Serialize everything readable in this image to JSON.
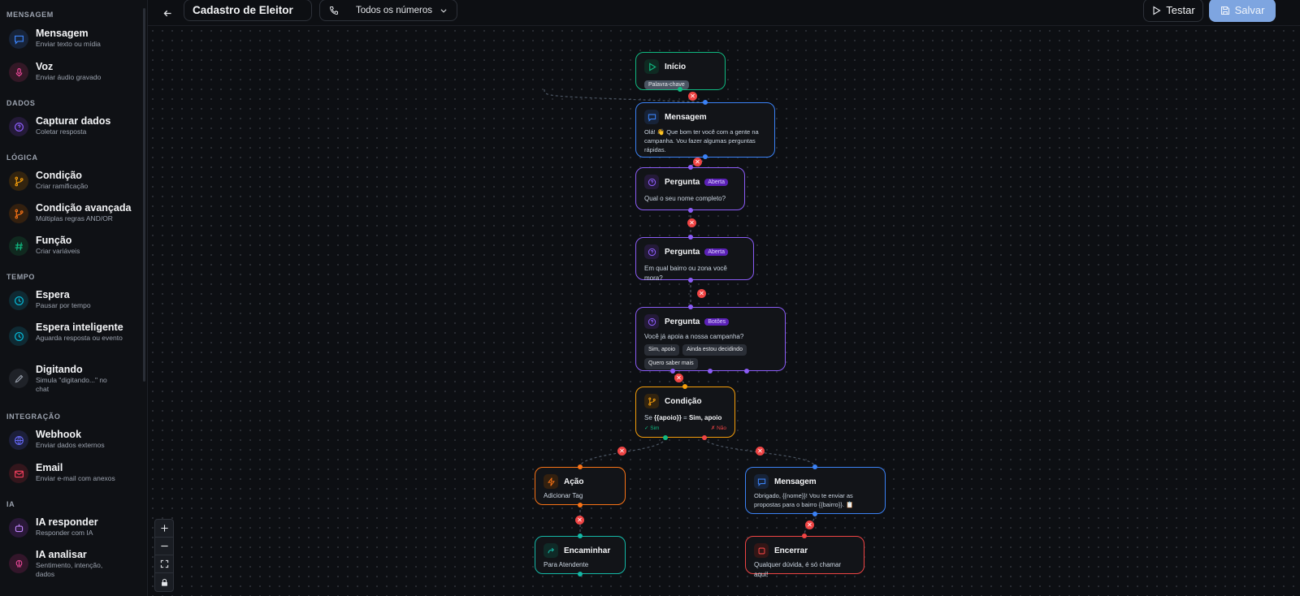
{
  "sidebar": {
    "sections": {
      "mensagem": "MENSAGEM",
      "dados": "DADOS",
      "logica": "LÓGICA",
      "tempo": "TEMPO",
      "integracao": "INTEGRAÇÃO",
      "ia": "IA"
    },
    "items": {
      "mensagem": {
        "title": "Mensagem",
        "sub": "Enviar texto ou mídia",
        "icon": "message-icon"
      },
      "voz": {
        "title": "Voz",
        "sub": "Enviar áudio gravado",
        "icon": "mic-icon"
      },
      "capturar": {
        "title": "Capturar dados",
        "sub": "Coletar resposta",
        "icon": "question-icon"
      },
      "condicao": {
        "title": "Condição",
        "sub": "Criar ramificação",
        "icon": "branch-icon"
      },
      "condicao_av": {
        "title": "Condição avançada",
        "sub": "Múltiplas regras AND/OR",
        "icon": "branch-icon"
      },
      "funcao": {
        "title": "Função",
        "sub": "Criar variáveis",
        "icon": "hash-icon"
      },
      "espera": {
        "title": "Espera",
        "sub": "Pausar por tempo",
        "icon": "clock-icon"
      },
      "espera_int": {
        "title": "Espera inteligente",
        "sub": "Aguarda resposta ou evento",
        "icon": "clock-icon"
      },
      "digitando": {
        "title": "Digitando",
        "sub": "Simula \"digitando...\" no chat",
        "icon": "pencil-icon"
      },
      "webhook": {
        "title": "Webhook",
        "sub": "Enviar dados externos",
        "icon": "globe-icon"
      },
      "email": {
        "title": "Email",
        "sub": "Enviar e-mail com anexos",
        "icon": "mail-icon"
      },
      "ia_resp": {
        "title": "IA responder",
        "sub": "Responder com IA",
        "icon": "bot-icon"
      },
      "ia_anal": {
        "title": "IA analisar",
        "sub": "Sentimento, intenção, dados",
        "icon": "brain-icon"
      }
    }
  },
  "topbar": {
    "flow_name": "Cadastro de Eleitor",
    "numbers_select": "Todos os números",
    "test_label": "Testar",
    "save_label": "Salvar"
  },
  "nodes": {
    "inicio": {
      "title": "Início",
      "badge": "Palavra-chave"
    },
    "msg1": {
      "title": "Mensagem",
      "text": "Olá! 👋 Que bom ter você com a gente na campanha. Vou fazer algumas perguntas rápidas."
    },
    "perg1": {
      "title": "Pergunta",
      "badge": "Aberta",
      "text": "Qual o seu nome completo?"
    },
    "perg2": {
      "title": "Pergunta",
      "badge": "Aberta",
      "text": "Em qual bairro ou zona você mora?"
    },
    "perg3": {
      "title": "Pergunta",
      "badge": "Botões",
      "text": "Você já apoia a nossa campanha?",
      "chips": [
        "Sim, apoio",
        "Ainda estou decidindo",
        "Quero saber mais"
      ]
    },
    "cond": {
      "title": "Condição",
      "text_prefix": "Se ",
      "var": "{{apoio}}",
      "op": " = ",
      "value": "Sim, apoio",
      "yes": "✓ Sim",
      "no": "✗ Não"
    },
    "acao": {
      "title": "Ação",
      "text": "Adicionar Tag"
    },
    "msg2": {
      "title": "Mensagem",
      "text": "Obrigado, {{nome}}! Vou te enviar as propostas para o bairro {{bairro}}. 📋"
    },
    "encaminhar": {
      "title": "Encaminhar",
      "text": "Para Atendente"
    },
    "encerrar": {
      "title": "Encerrar",
      "text": "Qualquer dúvida, é só chamar aqui!"
    }
  },
  "colors": {
    "green": "#10b981",
    "blue": "#3b82f6",
    "purple": "#8b5cf6",
    "orange": "#f59e0b",
    "teal": "#14b8a6",
    "red": "#ef4444"
  }
}
